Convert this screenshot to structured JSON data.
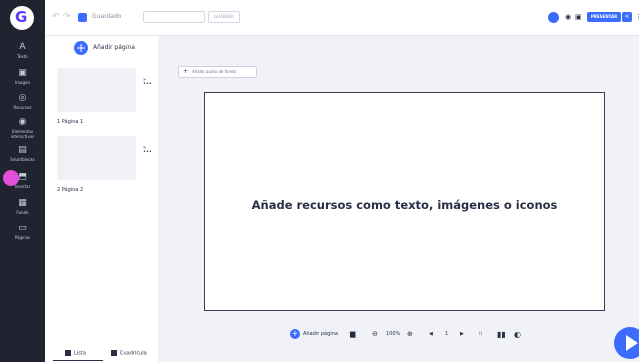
{
  "topbar": {
    "saved_label": "Guardado",
    "title_button": "GUARDAR",
    "present_label": "PRESENTAR",
    "undo_icon": "undo-icon",
    "redo_icon": "redo-icon"
  },
  "sidebar": {
    "items": [
      {
        "label": "Texto",
        "icon": "A"
      },
      {
        "label": "Imagen",
        "icon": "▣"
      },
      {
        "label": "Recursos",
        "icon": "◎"
      },
      {
        "label": "Elementos interactivos",
        "icon": "◉"
      },
      {
        "label": "Smartblocks",
        "icon": "▤"
      },
      {
        "label": "Insertar",
        "icon": "⬒"
      },
      {
        "label": "Fondo",
        "icon": "▦"
      },
      {
        "label": "Páginas",
        "icon": "▭"
      }
    ]
  },
  "panel": {
    "add_page_label": "Añadir página",
    "pages": [
      {
        "label": "1  Página 1"
      },
      {
        "label": "2  Página 2"
      }
    ],
    "footer": {
      "list_label": "Lista",
      "grid_label": "Cuadrícula"
    }
  },
  "canvas": {
    "audio_button_label": "Añade audio de fondo",
    "placeholder_text": "Añade recursos como texto, imágenes o iconos"
  },
  "bottom_toolbar": {
    "add_page_label": "Añadir página",
    "zoom": "100%",
    "page_number": "1"
  },
  "colors": {
    "accent": "#3b6cff",
    "sidebar": "#202431",
    "highlight": "#e24fd8"
  }
}
